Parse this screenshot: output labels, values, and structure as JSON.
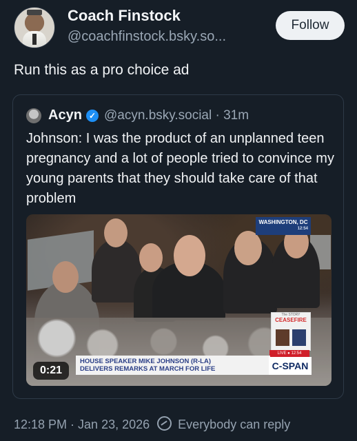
{
  "header": {
    "display_name": "Coach Finstock",
    "handle": "@coachfinstock.bsky.so...",
    "follow_label": "Follow"
  },
  "post": {
    "text": "Run this as a pro choice ad"
  },
  "quote": {
    "name": "Acyn",
    "handle": "@acyn.bsky.social · 31m",
    "text": "Johnson: I was the product of an unplanned teen pregnancy and a lot of people tried to convince my young parents that they should take care of that problem"
  },
  "video": {
    "duration": "0:21",
    "location_line1": "WASHINGTON, DC",
    "location_time": "12:54",
    "ceasefire_header": "The STORY",
    "ceasefire_word": "CEASEFIRE",
    "live_label": "LIVE ● 12:54",
    "lower_third_line1": "HOUSE SPEAKER MIKE JOHNSON (R-LA)",
    "lower_third_line2": "DELIVERS REMARKS AT MARCH FOR LIFE",
    "network": "C-SPAN"
  },
  "footer": {
    "timestamp": "12:18 PM · Jan 23, 2026",
    "reply_setting": "Everybody can reply"
  },
  "colors": {
    "background": "#161e27",
    "muted": "#9aa7b5",
    "verified_blue": "#1d8ff5"
  },
  "icons": [
    "avatar",
    "verified-icon",
    "globe-icon"
  ]
}
